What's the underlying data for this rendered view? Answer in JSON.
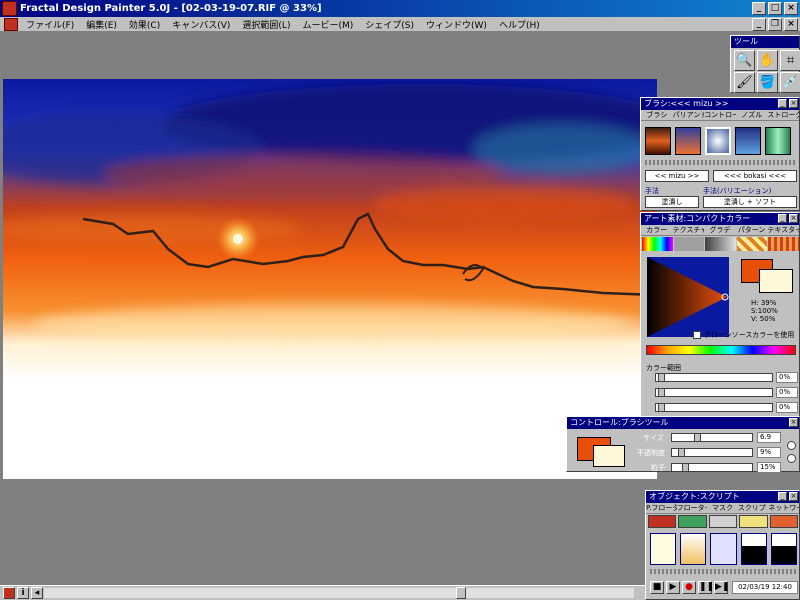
{
  "window": {
    "title": "Fractal Design Painter 5.0J - [02-03-19-07.RIF @ 33%]"
  },
  "menu": [
    "ファイル(F)",
    "編集(E)",
    "効果(C)",
    "キャンバス(V)",
    "選択範囲(L)",
    "ムービー(M)",
    "シェイプ(S)",
    "ウィンドウ(W)",
    "ヘルプ(H)"
  ],
  "tools": {
    "title": "ツール"
  },
  "brush": {
    "title": "ブラシ:<<< mizu >>",
    "tabs": [
      "ブラシ",
      "パリアント",
      "コントロール",
      "ノズル",
      "ストローク"
    ],
    "mizu_btn": "<< mizu >>",
    "bokasi_btn": "<<< bokasi <<<",
    "method_label": "手法",
    "variation_label": "手法(バリエーション)",
    "method_value": "塗潰し",
    "variation_value": "塗潰し + ソフト"
  },
  "art": {
    "title": "アート素材:コンパクトカラー",
    "tabs": [
      "カラー",
      "テクスチャ",
      "グラデ",
      "パターン",
      "テキスタイル"
    ],
    "h": "H: 39%",
    "s": "S:100%",
    "v": "V: 50%",
    "clone_label": "クローンソースカラーを使用",
    "range_label": "カラー範囲",
    "range_values": [
      "0%",
      "0%",
      "0%"
    ]
  },
  "control": {
    "title": "コントロール:ブラシツール",
    "labels": [
      "サイズ",
      "不透明度",
      "粒子"
    ],
    "values": [
      "6.9",
      "9%",
      "15%"
    ]
  },
  "object": {
    "title": "オブジェクト:スクリプト",
    "tabs": [
      "P.フローター",
      "フローター",
      "マスク",
      "スクリプト",
      "ネットワーク"
    ],
    "timestamp": "02/03/19 12:40"
  },
  "colors": {
    "primary": "#e8500a",
    "secondary": "#fff8d8",
    "titlebar": "#000080"
  }
}
